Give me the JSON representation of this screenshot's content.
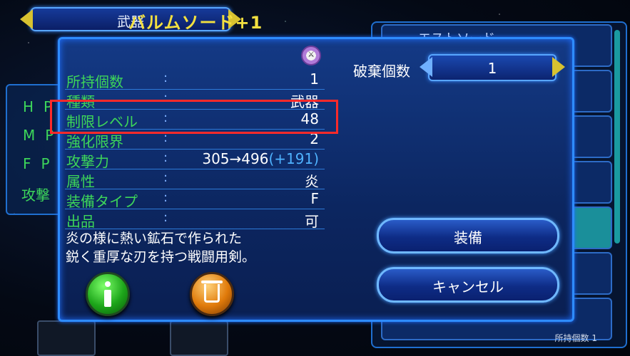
{
  "category": {
    "label": "武器"
  },
  "background_left": {
    "stats": [
      "HP",
      "MP",
      "FP",
      "攻撃"
    ]
  },
  "background_right": {
    "first_item": "エストソード",
    "footer": "所持個数 1"
  },
  "item": {
    "name": "バルムソード+1",
    "rows": [
      {
        "key": "所持個数",
        "value": "1"
      },
      {
        "key": "種類",
        "value": "武器"
      },
      {
        "key": "制限レベル",
        "value": "48"
      },
      {
        "key": "強化限界",
        "value": "2"
      },
      {
        "key": "攻撃力",
        "value": "305→496",
        "bonus": "(+191)"
      },
      {
        "key": "属性",
        "value": "炎"
      },
      {
        "key": "装備タイプ",
        "value": "F"
      },
      {
        "key": "出品",
        "value": "可"
      }
    ],
    "separator": ":",
    "description": [
      "炎の様に熱い鉱石で作られた",
      "鋭く重厚な刃を持つ戦闘用剣。"
    ]
  },
  "discard": {
    "label": "破棄個数",
    "quantity": "1"
  },
  "buttons": {
    "equip": "装備",
    "cancel": "キャンセル"
  },
  "icons": {
    "info": "info-icon",
    "trash": "trash-icon",
    "item_type": "item-type-icon"
  },
  "colors": {
    "title": "#f3e040",
    "key": "#3dd65a",
    "bonus": "#4fb3ff",
    "highlight": "#ff2a2a"
  }
}
